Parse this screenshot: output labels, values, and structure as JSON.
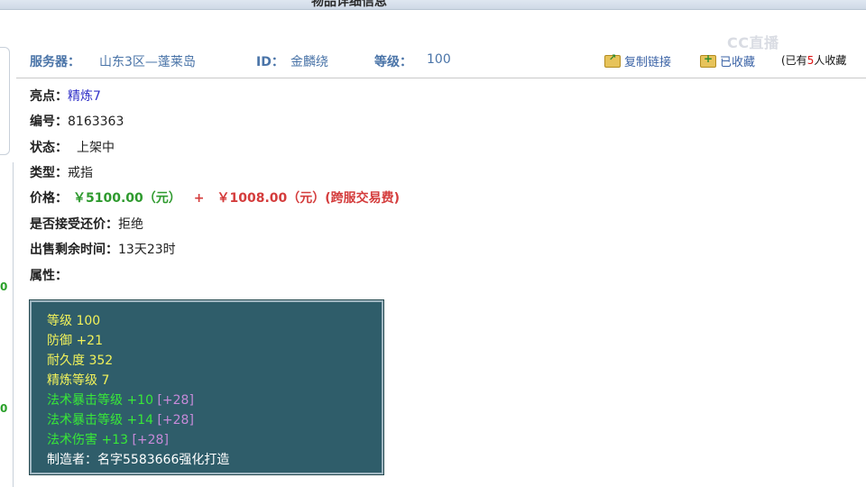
{
  "page": {
    "title": "物品详细信息"
  },
  "left": {
    "numbers": [
      "0",
      "0"
    ]
  },
  "header": {
    "server_label": "服务器：",
    "server_value": "山东3区—蓬莱岛",
    "id_label": "ID：",
    "id_value": "金麟绕",
    "level_label": "等级：",
    "level_value": "100",
    "copy_link": "复制链接",
    "favorited": "已收藏",
    "fav_count_prefix": "(已有",
    "fav_count": "5",
    "fav_count_suffix": "人收藏"
  },
  "watermark": "CC直播",
  "details": {
    "highlight_label": "亮点：",
    "highlight_value": "精炼7",
    "number_label": "编号：",
    "number_value": "8163363",
    "status_label": "状态：",
    "status_value": "上架中",
    "type_label": "类型：",
    "type_value": "戒指",
    "price_label": "价格：",
    "price_value": "￥5100.00（元）",
    "price_plus": "+",
    "fee_value": "￥1008.00（元）(跨服交易费)",
    "bargain_label": "是否接受还价：",
    "bargain_value": "拒绝",
    "time_label": "出售剩余时间：",
    "time_value": "13天23时",
    "attr_label": "属性："
  },
  "attributes": {
    "level": "等级 100",
    "defense": "防御 +21",
    "durability": "耐久度 352",
    "refine": "精炼等级 7",
    "crit1": "法术暴击等级 +10",
    "crit1_bonus": "[+28]",
    "crit2": "法术暴击等级 +14",
    "crit2_bonus": "[+28]",
    "dmg": "法术伤害 +13",
    "dmg_bonus": "[+28]",
    "maker": "制造者：名字5583666强化打造"
  }
}
